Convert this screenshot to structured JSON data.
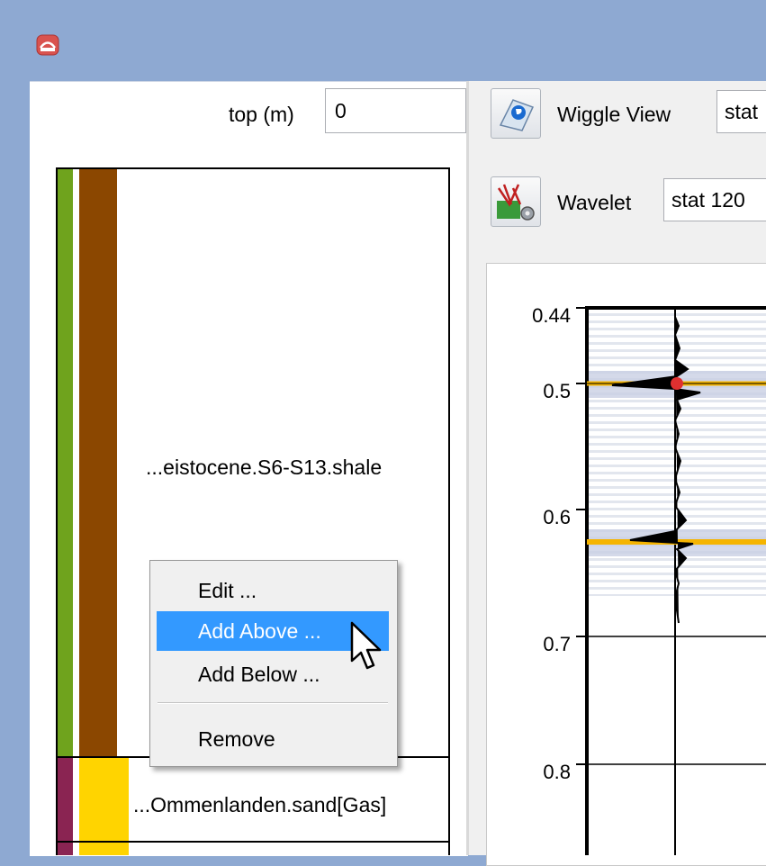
{
  "left_panel": {
    "top_label": "top (m)",
    "top_value": "0",
    "units": [
      {
        "label": "...eistocene.S6-S13.shale",
        "colors": [
          "#6fa31d",
          "#8b4700"
        ]
      },
      {
        "label": "...Ommenlanden.sand[Gas]",
        "colors": [
          "#8a2452",
          "#ffd400"
        ]
      }
    ]
  },
  "right_panel": {
    "wiggle_view_label": "Wiggle View",
    "wiggle_view_value": "stat",
    "wavelet_label": "Wavelet",
    "wavelet_value": "stat 120",
    "time_axis_ticks": [
      "0.44",
      "0.5",
      "0.6",
      "0.7",
      "0.8"
    ]
  },
  "context_menu": {
    "items": [
      "Edit ...",
      "Add Above ...",
      "Add Below ...",
      "Remove"
    ],
    "highlighted": "Add Above ..."
  },
  "colors": {
    "title_bar": "#8ea9d2",
    "menu_highlight": "#3399ff",
    "event_line": "#f5b400",
    "marker": "#e03030"
  },
  "icons": [
    "app-icon",
    "wiggle-view-icon",
    "wavelet-icon",
    "mouse-pointer-icon"
  ]
}
